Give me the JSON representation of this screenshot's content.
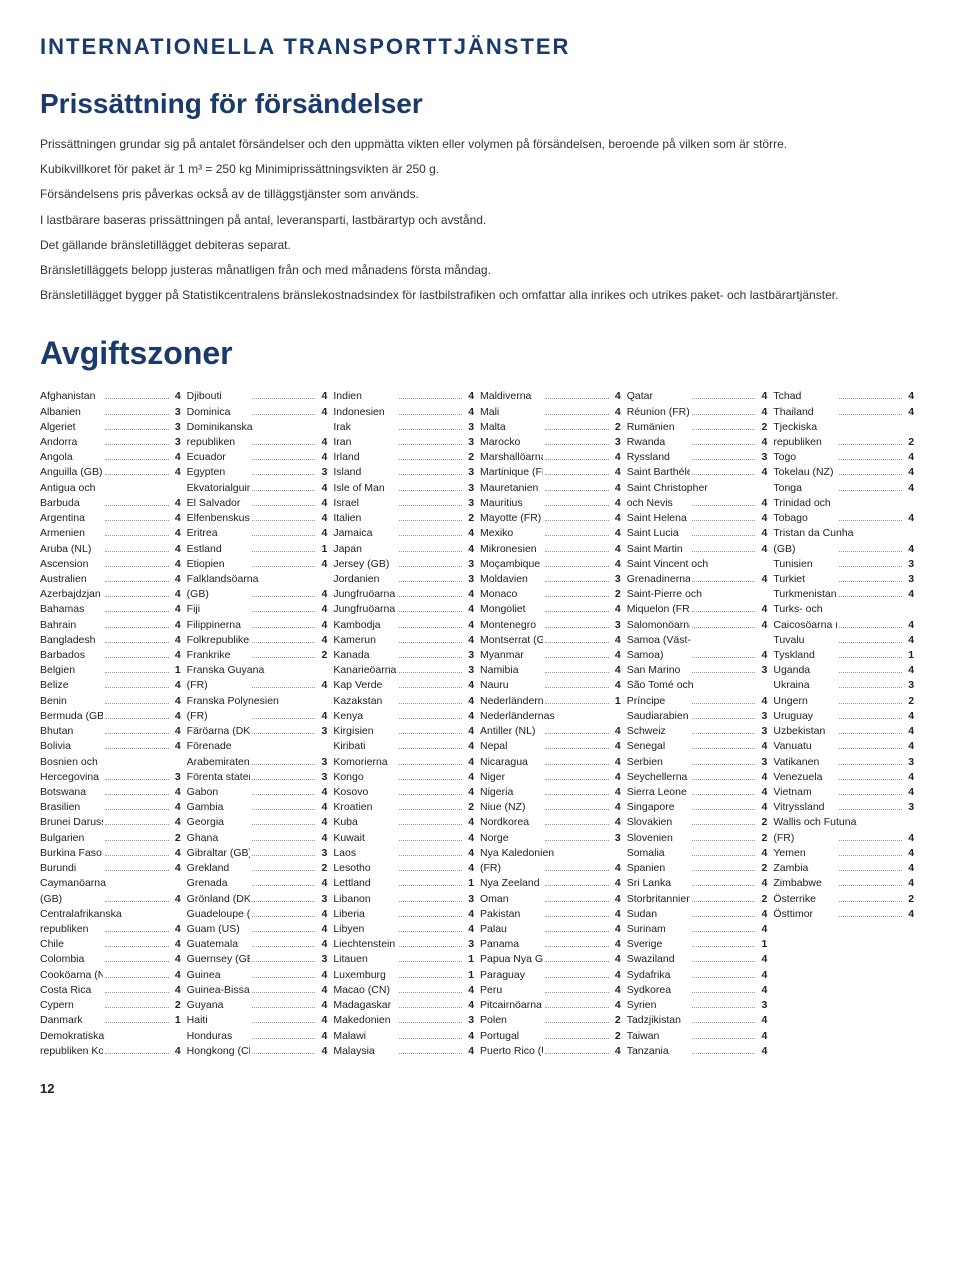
{
  "header": {
    "title": "INTERNATIONELLA TRANSPORTTJÄNSTER",
    "section": "Prissättning för försändelser",
    "intro1": "Prissättningen grundar sig på antalet försändelser och den uppmätta vikten eller volymen på försändelsen, beroende på vilken som är större.",
    "intro2": "Kubikvillkoret för paket är 1 m³ = 250 kg Minimiprissättningsvikten är 250 g.",
    "intro3": "Försändelsens pris påverkas också av de tilläggstjänster som används.",
    "intro4": "I lastbärare baseras prissättningen på antal, leveransparti, lastbärartyp och avstånd.",
    "intro5": "Det gällande bränsletillägget debiteras separat.",
    "intro6": "Bränsletilläggets belopp justeras månatligen från och med månadens första måndag.",
    "intro7": "Bränsletillägget bygger på Statistikcentralens bränslekostnadsindex för lastbilstrafiken och omfattar alla inrikes och utrikes paket- och lastbärartjänster.",
    "avgiftszoner": "Avgiftszoner"
  },
  "col1": [
    {
      "name": "Afghanistan",
      "num": "4"
    },
    {
      "name": "Albanien",
      "num": "3"
    },
    {
      "name": "Algeriet",
      "num": "3"
    },
    {
      "name": "Andorra",
      "num": "3"
    },
    {
      "name": "Angola",
      "num": "4"
    },
    {
      "name": "Anguilla (GB)",
      "num": "4"
    },
    {
      "name": "Antigua och"
    },
    {
      "name": "Barbuda",
      "num": "4"
    },
    {
      "name": "Argentina",
      "num": "4"
    },
    {
      "name": "Armenien",
      "num": "4"
    },
    {
      "name": "Aruba (NL)",
      "num": "4"
    },
    {
      "name": "Ascension",
      "num": "4"
    },
    {
      "name": "Australien",
      "num": "4"
    },
    {
      "name": "Azerbajdzjan",
      "num": "4"
    },
    {
      "name": "Bahamas",
      "num": "4"
    },
    {
      "name": "Bahrain",
      "num": "4"
    },
    {
      "name": "Bangladesh",
      "num": "4"
    },
    {
      "name": "Barbados",
      "num": "4"
    },
    {
      "name": "Belgien",
      "num": "1"
    },
    {
      "name": "Belize",
      "num": "4"
    },
    {
      "name": "Benin",
      "num": "4"
    },
    {
      "name": "Bermuda (GB)",
      "num": "4"
    },
    {
      "name": "Bhutan",
      "num": "4"
    },
    {
      "name": "Bolivia",
      "num": "4"
    },
    {
      "name": "Bosnien och"
    },
    {
      "name": "Hercegovina",
      "num": "3"
    },
    {
      "name": "Botswana",
      "num": "4"
    },
    {
      "name": "Brasilien",
      "num": "4"
    },
    {
      "name": "Brunei Darussalam",
      "num": "4"
    },
    {
      "name": "Bulgarien",
      "num": "2"
    },
    {
      "name": "Burkina Faso",
      "num": "4"
    },
    {
      "name": "Burundi",
      "num": "4"
    },
    {
      "name": "Caymanöarna"
    },
    {
      "name": "(GB)",
      "num": "4"
    },
    {
      "name": "Centralafrikanska"
    },
    {
      "name": "republiken",
      "num": "4"
    },
    {
      "name": "Chile",
      "num": "4"
    },
    {
      "name": "Colombia",
      "num": "4"
    },
    {
      "name": "Cooköarna (NZ)",
      "num": "4"
    },
    {
      "name": "Costa Rica",
      "num": "4"
    },
    {
      "name": "Cypern",
      "num": "2"
    },
    {
      "name": "Danmark",
      "num": "1"
    },
    {
      "name": "Demokratiska"
    },
    {
      "name": "republiken Kongo",
      "num": "4"
    }
  ],
  "col2": [
    {
      "name": "Djibouti",
      "num": "4"
    },
    {
      "name": "Dominica",
      "num": "4"
    },
    {
      "name": "Dominikanska"
    },
    {
      "name": "republiken",
      "num": "4"
    },
    {
      "name": "Ecuador",
      "num": "4"
    },
    {
      "name": "Egypten",
      "num": "3"
    },
    {
      "name": "Ekvatorialguinea",
      "num": "4"
    },
    {
      "name": "El Salvador",
      "num": "4"
    },
    {
      "name": "Elfenbenskusten",
      "num": "4"
    },
    {
      "name": "Eritrea",
      "num": "4"
    },
    {
      "name": "Estland",
      "num": "1"
    },
    {
      "name": "Etiopien",
      "num": "4"
    },
    {
      "name": "Falklandsöarna"
    },
    {
      "name": "(GB)",
      "num": "4"
    },
    {
      "name": "Fiji",
      "num": "4"
    },
    {
      "name": "Filippinerna",
      "num": "4"
    },
    {
      "name": "Folkrepubliken Kina",
      "num": "4"
    },
    {
      "name": "Frankrike",
      "num": "2"
    },
    {
      "name": "Franska Guyana"
    },
    {
      "name": "(FR)",
      "num": "4"
    },
    {
      "name": "Franska Polynesien"
    },
    {
      "name": "(FR)",
      "num": "4"
    },
    {
      "name": "Färöarna (DK)",
      "num": "3"
    },
    {
      "name": "Förenade"
    },
    {
      "name": "Arabemiraten",
      "num": "3"
    },
    {
      "name": "Förenta staterna",
      "num": "3"
    },
    {
      "name": "Gabon",
      "num": "4"
    },
    {
      "name": "Gambia",
      "num": "4"
    },
    {
      "name": "Georgia",
      "num": "4"
    },
    {
      "name": "Ghana",
      "num": "4"
    },
    {
      "name": "Gibraltar (GB)",
      "num": "3"
    },
    {
      "name": "Grekland",
      "num": "2"
    },
    {
      "name": "Grenada",
      "num": "4"
    },
    {
      "name": "Grönland (DK)",
      "num": "3"
    },
    {
      "name": "Guadeloupe (FR)",
      "num": "4"
    },
    {
      "name": "Guam (US)",
      "num": "4"
    },
    {
      "name": "Guatemala",
      "num": "4"
    },
    {
      "name": "Guernsey (GB)",
      "num": "3"
    },
    {
      "name": "Guinea",
      "num": "4"
    },
    {
      "name": "Guinea-Bissau",
      "num": "4"
    },
    {
      "name": "Guyana",
      "num": "4"
    },
    {
      "name": "Haiti",
      "num": "4"
    },
    {
      "name": "Honduras",
      "num": "4"
    },
    {
      "name": "Hongkong (CN)",
      "num": "4"
    }
  ],
  "col3": [
    {
      "name": "Indien",
      "num": "4"
    },
    {
      "name": "Indonesien",
      "num": "4"
    },
    {
      "name": "Irak",
      "num": "3"
    },
    {
      "name": "Iran",
      "num": "3"
    },
    {
      "name": "Irland",
      "num": "2"
    },
    {
      "name": "Island",
      "num": "3"
    },
    {
      "name": "Isle of Man",
      "num": "3"
    },
    {
      "name": "Israel",
      "num": "3"
    },
    {
      "name": "Italien",
      "num": "2"
    },
    {
      "name": "Jamaica",
      "num": "4"
    },
    {
      "name": "Japan",
      "num": "4"
    },
    {
      "name": "Jersey (GB)",
      "num": "3"
    },
    {
      "name": "Jordanien",
      "num": "3"
    },
    {
      "name": "Jungfruöarna (GB)",
      "num": "4"
    },
    {
      "name": "Jungfruöarna (US)",
      "num": "4"
    },
    {
      "name": "Kambodja",
      "num": "4"
    },
    {
      "name": "Kamerun",
      "num": "4"
    },
    {
      "name": "Kanada",
      "num": "3"
    },
    {
      "name": "Kanarieöarna (ES)",
      "num": "3"
    },
    {
      "name": "Kap Verde",
      "num": "4"
    },
    {
      "name": "Kazakstan",
      "num": "4"
    },
    {
      "name": "Kenya",
      "num": "4"
    },
    {
      "name": "Kirgisien",
      "num": "4"
    },
    {
      "name": "Kiribati",
      "num": "4"
    },
    {
      "name": "Komorierna",
      "num": "4"
    },
    {
      "name": "Kongo",
      "num": "4"
    },
    {
      "name": "Kosovo",
      "num": "4"
    },
    {
      "name": "Kroatien",
      "num": "2"
    },
    {
      "name": "Kuba",
      "num": "4"
    },
    {
      "name": "Kuwait",
      "num": "4"
    },
    {
      "name": "Laos",
      "num": "4"
    },
    {
      "name": "Lesotho",
      "num": "4"
    },
    {
      "name": "Lettland",
      "num": "1"
    },
    {
      "name": "Libanon",
      "num": "3"
    },
    {
      "name": "Liberia",
      "num": "4"
    },
    {
      "name": "Libyen",
      "num": "4"
    },
    {
      "name": "Liechtenstein",
      "num": "3"
    },
    {
      "name": "Litauen",
      "num": "1"
    },
    {
      "name": "Luxemburg",
      "num": "1"
    },
    {
      "name": "Macao (CN)",
      "num": "4"
    },
    {
      "name": "Madagaskar",
      "num": "4"
    },
    {
      "name": "Makedonien",
      "num": "3"
    },
    {
      "name": "Malawi",
      "num": "4"
    },
    {
      "name": "Malaysia",
      "num": "4"
    }
  ],
  "col4": [
    {
      "name": "Maldiverna",
      "num": "4"
    },
    {
      "name": "Mali",
      "num": "4"
    },
    {
      "name": "Malta",
      "num": "2"
    },
    {
      "name": "Marocko",
      "num": "3"
    },
    {
      "name": "Marshallöarna (US)",
      "num": "4"
    },
    {
      "name": "Martinique (FR)",
      "num": "4"
    },
    {
      "name": "Mauretanien",
      "num": "4"
    },
    {
      "name": "Mauritius",
      "num": "4"
    },
    {
      "name": "Mayotte (FR)",
      "num": "4"
    },
    {
      "name": "Mexiko",
      "num": "4"
    },
    {
      "name": "Mikronesien",
      "num": "4"
    },
    {
      "name": "Moçambique",
      "num": "4"
    },
    {
      "name": "Moldavien",
      "num": "3"
    },
    {
      "name": "Monaco",
      "num": "2"
    },
    {
      "name": "Mongoliet",
      "num": "4"
    },
    {
      "name": "Montenegro",
      "num": "3"
    },
    {
      "name": "Montserrat (GB)",
      "num": "4"
    },
    {
      "name": "Myanmar",
      "num": "4"
    },
    {
      "name": "Namibia",
      "num": "4"
    },
    {
      "name": "Nauru",
      "num": "4"
    },
    {
      "name": "Nederländerna",
      "num": "1"
    },
    {
      "name": "Nederländernas"
    },
    {
      "name": "Antiller (NL)",
      "num": "4"
    },
    {
      "name": "Nepal",
      "num": "4"
    },
    {
      "name": "Nicaragua",
      "num": "4"
    },
    {
      "name": "Niger",
      "num": "4"
    },
    {
      "name": "Nigeria",
      "num": "4"
    },
    {
      "name": "Niue (NZ)",
      "num": "4"
    },
    {
      "name": "Nordkorea",
      "num": "4"
    },
    {
      "name": "Norge",
      "num": "3"
    },
    {
      "name": "Nya Kaledonien"
    },
    {
      "name": "(FR)",
      "num": "4"
    },
    {
      "name": "Nya Zeeland",
      "num": "4"
    },
    {
      "name": "Oman",
      "num": "4"
    },
    {
      "name": "Pakistan",
      "num": "4"
    },
    {
      "name": "Palau",
      "num": "4"
    },
    {
      "name": "Panama",
      "num": "4"
    },
    {
      "name": "Papua Nya Guinea",
      "num": "4"
    },
    {
      "name": "Paraguay",
      "num": "4"
    },
    {
      "name": "Peru",
      "num": "4"
    },
    {
      "name": "Pitcairnöarna (GB)",
      "num": "4"
    },
    {
      "name": "Polen",
      "num": "2"
    },
    {
      "name": "Portugal",
      "num": "2"
    },
    {
      "name": "Puerto Rico (US)",
      "num": "4"
    }
  ],
  "col5": [
    {
      "name": "Qatar",
      "num": "4"
    },
    {
      "name": "Réunion (FR)",
      "num": "4"
    },
    {
      "name": "Rumänien",
      "num": "2"
    },
    {
      "name": "Rwanda",
      "num": "4"
    },
    {
      "name": "Ryssland",
      "num": "3"
    },
    {
      "name": "Saint Barthélemy",
      "num": "4"
    },
    {
      "name": "Saint Christopher"
    },
    {
      "name": "och Nevis",
      "num": "4"
    },
    {
      "name": "Saint Helena (GB)",
      "num": "4"
    },
    {
      "name": "Saint Lucia",
      "num": "4"
    },
    {
      "name": "Saint Martin",
      "num": "4"
    },
    {
      "name": "Saint Vincent och"
    },
    {
      "name": "Grenadinerna",
      "num": "4"
    },
    {
      "name": "Saint-Pierre och"
    },
    {
      "name": "Miquelon (FR)",
      "num": "4"
    },
    {
      "name": "Salomonöarna",
      "num": "4"
    },
    {
      "name": "Samoa (Väst-"
    },
    {
      "name": "Samoa)",
      "num": "4"
    },
    {
      "name": "San Marino",
      "num": "3"
    },
    {
      "name": "São Tomé och"
    },
    {
      "name": "Príncipe",
      "num": "4"
    },
    {
      "name": "Saudiarabien",
      "num": "3"
    },
    {
      "name": "Schweiz",
      "num": "3"
    },
    {
      "name": "Senegal",
      "num": "4"
    },
    {
      "name": "Serbien",
      "num": "3"
    },
    {
      "name": "Seychellerna",
      "num": "4"
    },
    {
      "name": "Sierra Leone",
      "num": "4"
    },
    {
      "name": "Singapore",
      "num": "4"
    },
    {
      "name": "Slovakien",
      "num": "2"
    },
    {
      "name": "Slovenien",
      "num": "2"
    },
    {
      "name": "Somalia",
      "num": "4"
    },
    {
      "name": "Spanien",
      "num": "2"
    },
    {
      "name": "Sri Lanka",
      "num": "4"
    },
    {
      "name": "Storbritannien",
      "num": "2"
    },
    {
      "name": "Sudan",
      "num": "4"
    },
    {
      "name": "Surinam",
      "num": "4"
    },
    {
      "name": "Sverige",
      "num": "1"
    },
    {
      "name": "Swaziland",
      "num": "4"
    },
    {
      "name": "Sydafrika",
      "num": "4"
    },
    {
      "name": "Sydkorea",
      "num": "4"
    },
    {
      "name": "Syrien",
      "num": "3"
    },
    {
      "name": "Tadzjikistan",
      "num": "4"
    },
    {
      "name": "Taiwan",
      "num": "4"
    },
    {
      "name": "Tanzania",
      "num": "4"
    }
  ],
  "col6": [
    {
      "name": "Tchad",
      "num": "4"
    },
    {
      "name": "Thailand",
      "num": "4"
    },
    {
      "name": "Tjeckiska"
    },
    {
      "name": "republiken",
      "num": "2"
    },
    {
      "name": "Togo",
      "num": "4"
    },
    {
      "name": "Tokelau (NZ)",
      "num": "4"
    },
    {
      "name": "Tonga",
      "num": "4"
    },
    {
      "name": "Trinidad och"
    },
    {
      "name": "Tobago",
      "num": "4"
    },
    {
      "name": "Tristan da Cunha"
    },
    {
      "name": "(GB)",
      "num": "4"
    },
    {
      "name": "Tunisien",
      "num": "3"
    },
    {
      "name": "Turkiet",
      "num": "3"
    },
    {
      "name": "Turkmenistan",
      "num": "4"
    },
    {
      "name": "Turks- och"
    },
    {
      "name": "Caicosöarna (GB)",
      "num": "4"
    },
    {
      "name": "Tuvalu",
      "num": "4"
    },
    {
      "name": "Tyskland",
      "num": "1"
    },
    {
      "name": "Uganda",
      "num": "4"
    },
    {
      "name": "Ukraina",
      "num": "3"
    },
    {
      "name": "Ungern",
      "num": "2"
    },
    {
      "name": "Uruguay",
      "num": "4"
    },
    {
      "name": "Uzbekistan",
      "num": "4"
    },
    {
      "name": "Vanuatu",
      "num": "4"
    },
    {
      "name": "Vatikanen",
      "num": "3"
    },
    {
      "name": "Venezuela",
      "num": "4"
    },
    {
      "name": "Vietnam",
      "num": "4"
    },
    {
      "name": "Vitryssland",
      "num": "3"
    },
    {
      "name": "Wallis och Futuna"
    },
    {
      "name": "(FR)",
      "num": "4"
    },
    {
      "name": "Yemen",
      "num": "4"
    },
    {
      "name": "Zambia",
      "num": "4"
    },
    {
      "name": "Zimbabwe",
      "num": "4"
    },
    {
      "name": "Österrike",
      "num": "2"
    },
    {
      "name": "Östtimor",
      "num": "4"
    }
  ],
  "page_number": "12"
}
